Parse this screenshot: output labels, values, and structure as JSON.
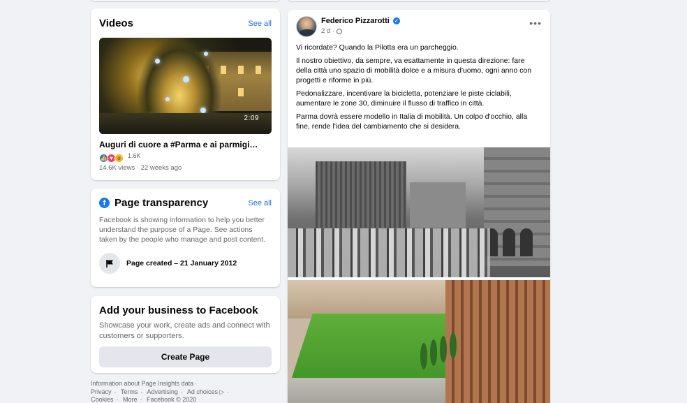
{
  "videos": {
    "title": "Videos",
    "see_all": "See all",
    "video": {
      "duration": "2:09",
      "title": "Auguri di cuore a #Parma e ai parmigi…",
      "reaction_count": "1.6K",
      "meta": "14.6K views · 22 weeks ago"
    }
  },
  "transparency": {
    "title": "Page transparency",
    "see_all": "See all",
    "description": "Facebook is showing information to help you better understand the purpose of a Page. See actions taken by the people who manage and post content.",
    "created": "Page created – 21 January 2012"
  },
  "business": {
    "title": "Add your business to Facebook",
    "description": "Showcase your work, create ads and connect with customers or supporters.",
    "button": "Create Page"
  },
  "footer": {
    "insights": "Information about Page Insights data",
    "privacy": "Privacy",
    "terms": "Terms",
    "advertising": "Advertising",
    "ad_choices": "Ad choices",
    "cookies": "Cookies",
    "more": "More",
    "copyright": "Facebook © 2020"
  },
  "post": {
    "author": "Federico Pizzarotti",
    "timestamp": "2 d ·",
    "paragraphs": [
      "Vi ricordate? Quando la Pilotta era un parcheggio.",
      "Il nostro obiettivo, da sempre, va esattamente in questa direzione: fare della città uno spazio di mobilità dolce e a misura d'uomo, ogni anno con progetti e riforme in più.",
      "Pedonalizzare, incentivare la bicicletta, potenziare le piste ciclabili, aumentare le zone 30, diminuire il flusso di traffico in città.",
      "Parma dovrà essere modello in Italia di mobilità. Un colpo d'occhio, alla fine, rende l'idea del cambiamento che si desidera."
    ]
  },
  "colors": {
    "accent": "#216fdb",
    "background": "#f0f2f5",
    "muted_text": "#65676b"
  },
  "icons": [
    "fb-logo-icon",
    "flag-icon",
    "verified-icon",
    "globe-icon",
    "more-icon",
    "like-icon",
    "love-icon",
    "wow-icon",
    "ad-choices-icon"
  ]
}
